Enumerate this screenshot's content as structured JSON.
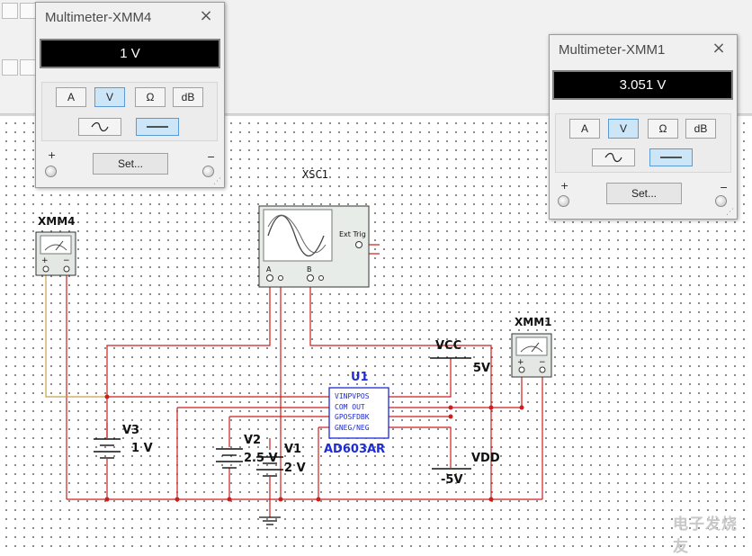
{
  "multimeter_xmm4": {
    "title": "Multimeter-XMM4",
    "close_glyph": "×",
    "reading": "1 V",
    "mode_buttons": [
      "A",
      "V",
      "Ω",
      "dB"
    ],
    "active_mode": "V",
    "active_wave": "dc",
    "set_label": "Set...",
    "plus_label": "+",
    "minus_label": "−"
  },
  "multimeter_xmm1": {
    "title": "Multimeter-XMM1",
    "close_glyph": "×",
    "reading": "3.051 V",
    "mode_buttons": [
      "A",
      "V",
      "Ω",
      "dB"
    ],
    "active_mode": "V",
    "active_wave": "dc",
    "set_label": "Set...",
    "plus_label": "+",
    "minus_label": "−"
  },
  "schematic": {
    "oscilloscope": {
      "ref": "XSC1",
      "ext_trig": "Ext Trig",
      "ch_a": "A",
      "ch_b": "B"
    },
    "meter_xmm4": {
      "ref": "XMM4"
    },
    "meter_xmm1": {
      "ref": "XMM1"
    },
    "v3": {
      "ref": "V3",
      "value": "1 V"
    },
    "v2": {
      "ref": "V2",
      "value": "2.5 V"
    },
    "v1": {
      "ref": "V1",
      "value": "2 V"
    },
    "vcc": {
      "ref": "VCC",
      "value": "5V"
    },
    "vdd": {
      "ref": "VDD",
      "value": "-5V"
    },
    "u1": {
      "ref": "U1",
      "part": "AD603AR",
      "pins": [
        "VINPVPOS",
        "COM   OUT",
        "GPOSFDBK",
        "GNEG/NEG"
      ]
    }
  },
  "watermark": "电子发烧友",
  "colors": {
    "wire": "#cc1f1f",
    "probe_wire": "#c8a24a",
    "component_blue": "#1e2bd6",
    "display_bg": "#000000",
    "active_button": "#cde6f7"
  }
}
